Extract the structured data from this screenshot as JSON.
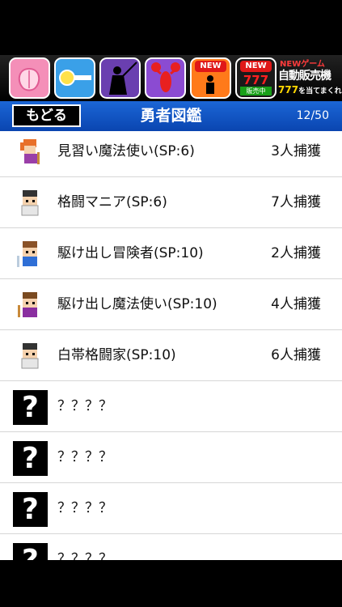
{
  "ad": {
    "apps": [
      {
        "name": "peach-app",
        "bg": "#f48fb8"
      },
      {
        "name": "key-app",
        "bg": "#3aa0e8"
      },
      {
        "name": "samurai-app",
        "bg": "#6a3fb0"
      },
      {
        "name": "lobster-app",
        "bg": "#8b4bd2"
      },
      {
        "name": "new-person-app",
        "bg": "#ff7a1a",
        "badge": "NEW"
      },
      {
        "name": "new-slot-app",
        "bg": "#1a1a1a",
        "badge": "NEW",
        "sub": "777",
        "tag": "販売中"
      }
    ],
    "promo": {
      "line1": "NEWゲーム",
      "line2": "自動販売機",
      "line3": "777",
      "line3_suffix": "を当てまくれ"
    }
  },
  "nav": {
    "back_label": "もどる",
    "title": "勇者図鑑",
    "count": "12/50"
  },
  "entries": [
    {
      "name": "見習い魔法使い(SP:6)",
      "count": "3人捕獲",
      "avatar": "mage-orange"
    },
    {
      "name": "格闘マニア(SP:6)",
      "count": "7人捕獲",
      "avatar": "fighter"
    },
    {
      "name": "駆け出し冒険者(SP:10)",
      "count": "2人捕獲",
      "avatar": "adventurer"
    },
    {
      "name": "駆け出し魔法使い(SP:10)",
      "count": "4人捕獲",
      "avatar": "mage-purple"
    },
    {
      "name": "白帯格闘家(SP:10)",
      "count": "6人捕獲",
      "avatar": "fighter"
    },
    {
      "name": "？？？？",
      "count": "",
      "avatar": "unknown"
    },
    {
      "name": "？？？？",
      "count": "",
      "avatar": "unknown"
    },
    {
      "name": "？？？？",
      "count": "",
      "avatar": "unknown"
    },
    {
      "name": "？？？？",
      "count": "",
      "avatar": "unknown"
    }
  ],
  "unknown_glyph": "?"
}
